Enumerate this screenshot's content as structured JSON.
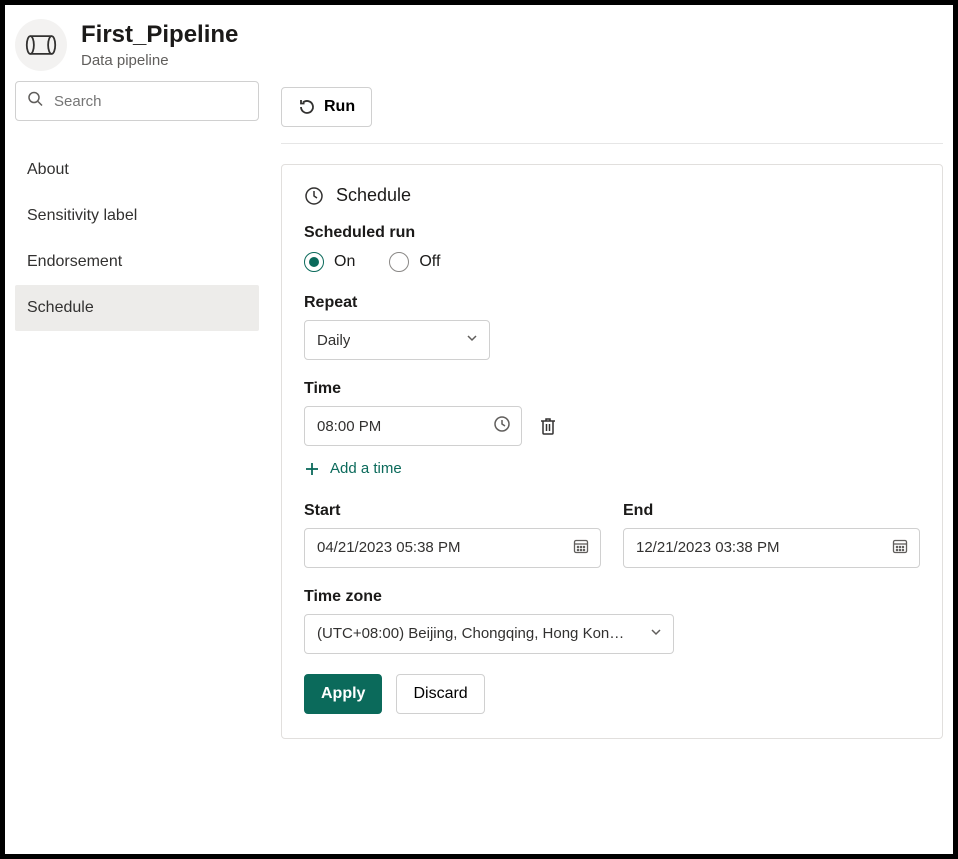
{
  "header": {
    "title": "First_Pipeline",
    "subtitle": "Data pipeline"
  },
  "search": {
    "placeholder": "Search",
    "value": ""
  },
  "nav": {
    "items": [
      "About",
      "Sensitivity label",
      "Endorsement",
      "Schedule"
    ],
    "selected": "Schedule"
  },
  "toolbar": {
    "run_label": "Run"
  },
  "schedule": {
    "card_title": "Schedule",
    "scheduled_run": {
      "label": "Scheduled run",
      "options": {
        "on": "On",
        "off": "Off"
      },
      "value": "on"
    },
    "repeat": {
      "label": "Repeat",
      "value": "Daily"
    },
    "time": {
      "label": "Time",
      "values": [
        "08:00 PM"
      ],
      "add_label": "Add a time"
    },
    "start": {
      "label": "Start",
      "value": "04/21/2023 05:38 PM"
    },
    "end": {
      "label": "End",
      "value": "12/21/2023 03:38 PM"
    },
    "timezone": {
      "label": "Time zone",
      "value": "(UTC+08:00) Beijing, Chongqing, Hong Kon…"
    },
    "actions": {
      "apply": "Apply",
      "discard": "Discard"
    }
  }
}
